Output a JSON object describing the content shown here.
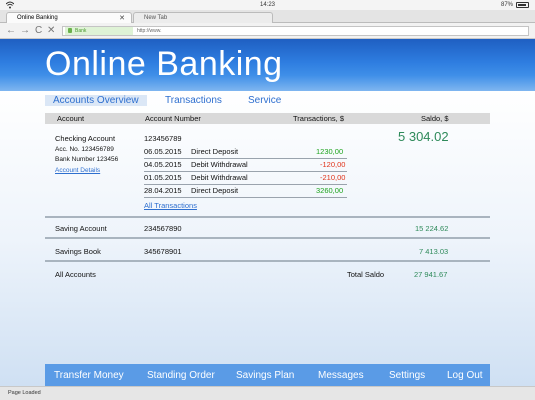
{
  "status_bar": {
    "time": "14:23",
    "battery": "87%"
  },
  "browser": {
    "tabs": [
      {
        "label": "Online Banking",
        "close": "✕"
      },
      {
        "label": "New Tab"
      }
    ],
    "nav": {
      "back": "←",
      "forward": "→",
      "reload": "C",
      "stop": "✕"
    },
    "address": {
      "secure_label": "Bank",
      "url": "http://www."
    }
  },
  "header": {
    "title": "Online Banking"
  },
  "top_nav": [
    "Accounts Overview",
    "Transactions",
    "Service"
  ],
  "table": {
    "headers": {
      "account": "Account",
      "account_number": "Account Number",
      "transactions": "Transactions, $",
      "saldo": "Saldo, $"
    },
    "checking": {
      "name": "Checking Account",
      "acc_no": "Acc. No. 123456789",
      "bank_no": "Bank Number 123456",
      "details_link": "Account Details",
      "number": "123456789",
      "saldo": "5 304.02",
      "transactions": [
        {
          "date": "06.05.2015",
          "desc": "Direct Deposit",
          "amount": "1230,00"
        },
        {
          "date": "04.05.2015",
          "desc": "Debit Withdrawal",
          "amount": "-120,00"
        },
        {
          "date": "01.05.2015",
          "desc": "Debit Withdrawal",
          "amount": "-210,00"
        },
        {
          "date": "28.04.2015",
          "desc": "Direct Deposit",
          "amount": "3260,00"
        }
      ],
      "all_link": "All Transactions"
    },
    "saving": {
      "name": "Saving Account",
      "number": "234567890",
      "saldo": "15 224.62"
    },
    "savings_book": {
      "name": "Savings Book",
      "number": "345678901",
      "saldo": "7 413.03"
    },
    "total": {
      "label": "All Accounts",
      "total_label": "Total Saldo",
      "value": "27 941.67"
    }
  },
  "bottom_nav": [
    "Transfer Money",
    "Standing Order",
    "Savings Plan",
    "Messages",
    "Settings",
    "Log Out"
  ],
  "status_line": "Page Loaded"
}
